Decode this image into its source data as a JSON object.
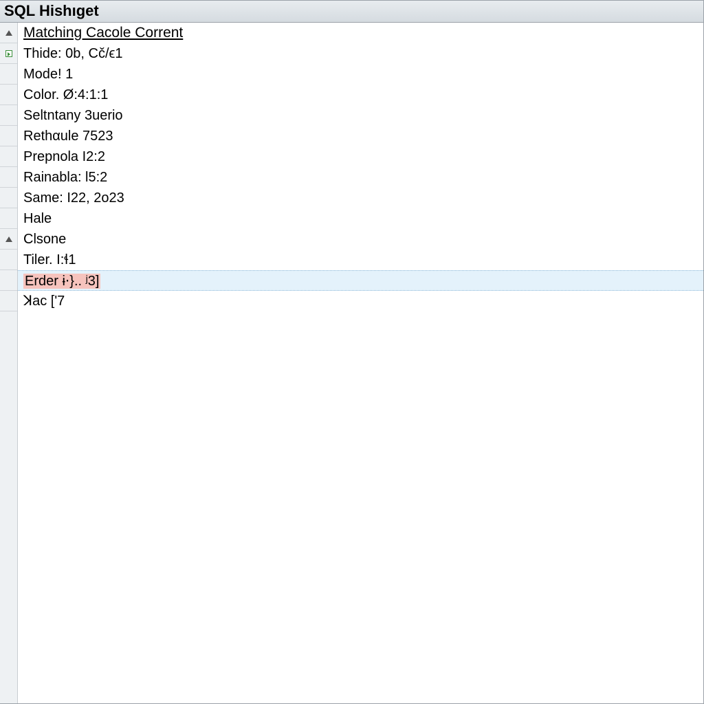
{
  "title": "SQL Hishıget",
  "header_label": "Matching Cacole Corrent",
  "rows": [
    {
      "text": "Thide:  0b, Cč/ϵ1",
      "gutter": "exec"
    },
    {
      "text": "Mode! 1"
    },
    {
      "text": "Color. Ø:4:1:1"
    },
    {
      "text": "Seltntany 3uerio"
    },
    {
      "text": "Rethαule 7523"
    },
    {
      "text": "Prepnola I2:2"
    },
    {
      "text": "Rainabla: l5:2"
    },
    {
      "text": "Same: I22, 2o23"
    },
    {
      "text": "Hale"
    },
    {
      "text": "Clsone",
      "gutter": "sort"
    },
    {
      "text": "Tiler. I:ɬ1"
    },
    {
      "text": "Erder ɨ⋅}.. ʲ3]",
      "selected": true,
      "error": true
    },
    {
      "text": "ꓘac ['7"
    }
  ]
}
